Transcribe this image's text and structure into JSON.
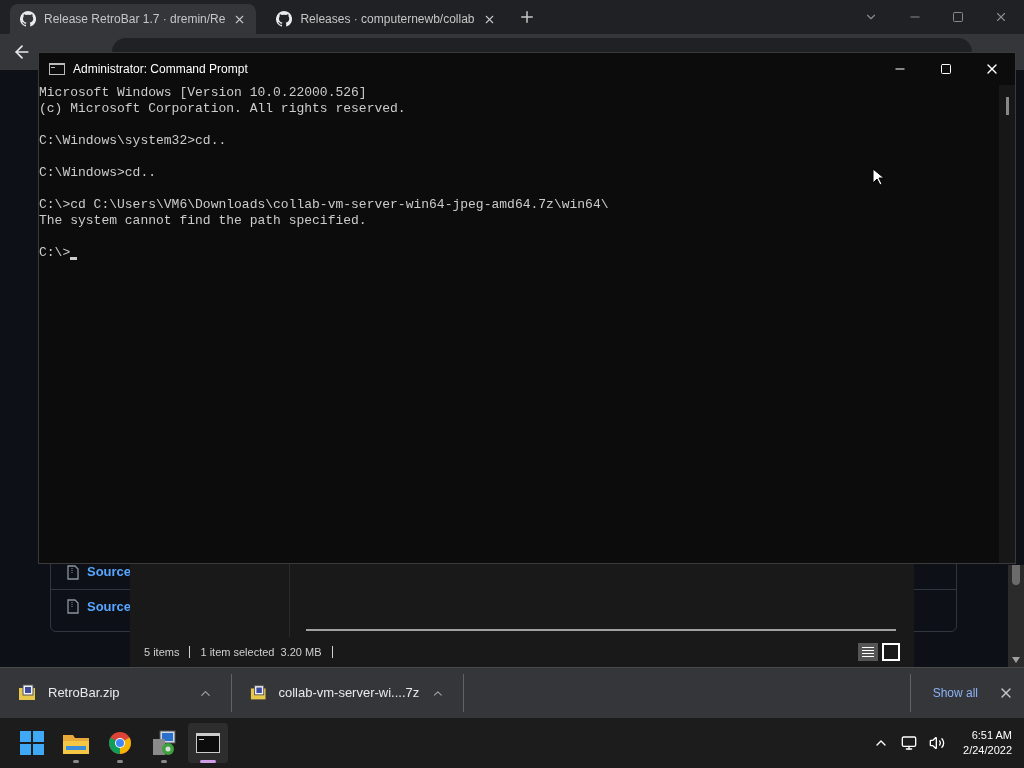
{
  "browser": {
    "tabs": [
      {
        "title": "Release RetroBar 1.7 · dremin/Re",
        "selected": true
      },
      {
        "title": "Releases · computernewb/collab",
        "selected": false
      }
    ]
  },
  "github_page": {
    "asset_links": [
      "Source",
      "Source"
    ]
  },
  "explorer": {
    "status": {
      "items": "5 items",
      "selection": "1 item selected  3.20 MB"
    }
  },
  "console": {
    "title": "Administrator: Command Prompt",
    "blocks": [
      [
        "Microsoft Windows [Version 10.0.22000.526]",
        "(c) Microsoft Corporation. All rights reserved."
      ],
      [
        "C:\\Windows\\system32>cd.."
      ],
      [
        "C:\\Windows>cd.."
      ],
      [
        "C:\\>cd C:\\Users\\VM6\\Downloads\\collab-vm-server-win64-jpeg-amd64.7z\\win64\\",
        "The system cannot find the path specified."
      ],
      [
        "C:\\>"
      ]
    ]
  },
  "downloads": {
    "items": [
      "RetroBar.zip",
      "collab-vm-server-wi....7z"
    ],
    "show_all": "Show all"
  },
  "taskbar": {
    "apps": [
      {
        "kind": "start",
        "selected": false
      },
      {
        "kind": "folder",
        "selected": false
      },
      {
        "kind": "chrome",
        "selected": false
      },
      {
        "kind": "installer",
        "selected": false
      },
      {
        "kind": "terminal",
        "selected": true
      }
    ],
    "time": "6:51 AM",
    "date": "2/24/2022"
  }
}
